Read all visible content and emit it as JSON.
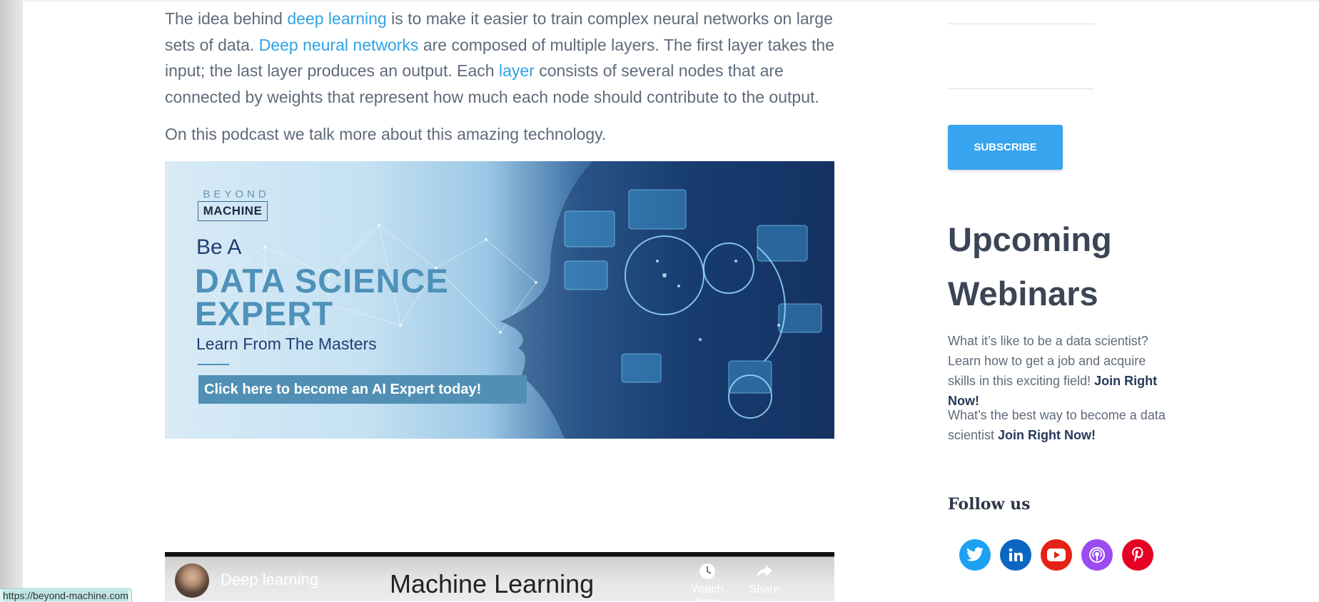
{
  "article": {
    "p1": {
      "t1": "The idea behind ",
      "l1": "deep learning",
      "t2": " is to make it easier to train complex neural networks on large sets of data. ",
      "l2": "Deep neural networks",
      "t3": " are composed of multiple layers. The first layer takes the input; the last layer produces an output. Each ",
      "l3": "layer",
      "t4": " consists of several nodes that are connected by weights that represent how much each node should contribute to the output."
    },
    "p2": "On this podcast we talk more about this amazing technology."
  },
  "banner": {
    "brand_small": "BEYOND",
    "brand_box": "MACHINE",
    "be_a": "Be A",
    "headline_1": "DATA SCIENCE",
    "headline_2": "EXPERT",
    "subline": "Learn From The Masters",
    "cta": "Click here to become an AI Expert today!"
  },
  "video": {
    "title": "Deep learning",
    "center_text": "Machine Learning",
    "watch_later": "Watch later",
    "share": "Share"
  },
  "status_bar": {
    "url": "https://beyond-machine.com"
  },
  "sidebar": {
    "subscribe_label": "SUBSCRIBE",
    "webinars_title": "Upcoming Webinars",
    "webinar_1_text": "What it’s like to be a data scientist? Learn how to get a job and acquire skills in this exciting field! ",
    "webinar_1_link": "Join Right Now!",
    "webinar_2_text": "What’s the best way to become a data scientist ",
    "webinar_2_link": "Join Right Now!",
    "follow_title": "Follow us",
    "social": [
      {
        "icon": "twitter-icon",
        "color": "#1da1f2"
      },
      {
        "icon": "linkedin-icon",
        "color": "#0a66c2"
      },
      {
        "icon": "youtube-icon",
        "color": "#e62117"
      },
      {
        "icon": "podcast-icon",
        "color": "#9b4cf0"
      },
      {
        "icon": "pinterest-icon",
        "color": "#e60023"
      }
    ]
  },
  "colors": {
    "link": "#2ea3e6",
    "body_text": "#5f6b7a",
    "subscribe_bg": "#37a4ef",
    "heading": "#3b4556"
  }
}
